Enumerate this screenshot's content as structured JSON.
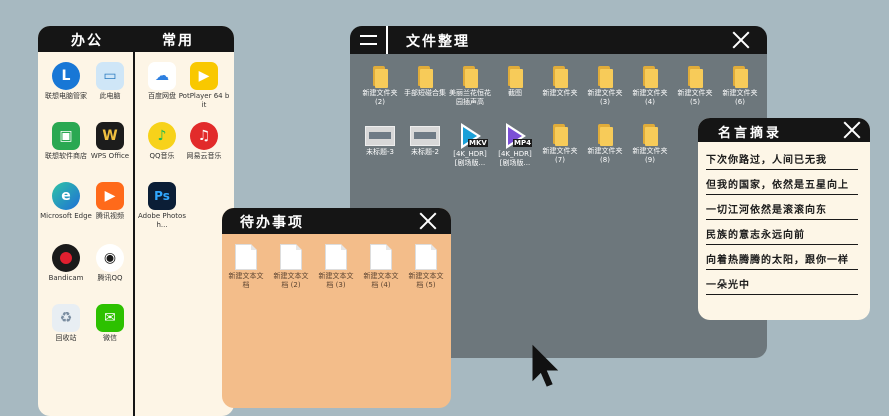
{
  "left_panel": {
    "col1_title": "办公",
    "col2_title": "常用",
    "col1_apps": [
      {
        "label": "联想电脑管家",
        "icon": "lenovo-icon"
      },
      {
        "label": "联想软件商店",
        "icon": "store-icon"
      },
      {
        "label": "Microsoft Edge",
        "icon": "edge-icon"
      },
      {
        "label": "Bandicam",
        "icon": "bandicam-icon"
      },
      {
        "label": "回收站",
        "icon": "recycle-bin-icon"
      }
    ],
    "col2_apps": [
      {
        "label": "此电脑",
        "icon": "computer-icon"
      },
      {
        "label": "WPS Office",
        "icon": "wps-icon"
      },
      {
        "label": "腾讯视频",
        "icon": "video-icon"
      },
      {
        "label": "腾讯QQ",
        "icon": "qq-icon"
      },
      {
        "label": "微信",
        "icon": "wechat-icon"
      }
    ],
    "col3_apps": [
      {
        "label": "百度网盘",
        "icon": "baidu-netdisk-icon"
      },
      {
        "label": "PotPlayer 64 bit",
        "icon": "potplayer-icon"
      },
      {
        "label": "QQ音乐",
        "icon": "qqmusic-icon"
      },
      {
        "label": "网易云音乐",
        "icon": "netease-music-icon"
      },
      {
        "label": "Adobe Photosh...",
        "icon": "photoshop-icon"
      }
    ]
  },
  "files_window": {
    "title": "文件整理",
    "row1": [
      {
        "label": "新建文件夹 (2)",
        "type": "folder"
      },
      {
        "label": "手部短碰合集",
        "type": "folder"
      },
      {
        "label": "美丽兰花恒花园插声高",
        "type": "folder"
      },
      {
        "label": "截图",
        "type": "folder"
      },
      {
        "label": "新建文件夹",
        "type": "folder"
      },
      {
        "label": "新建文件夹 (3)",
        "type": "folder"
      },
      {
        "label": "新建文件夹 (4)",
        "type": "folder"
      },
      {
        "label": "新建文件夹 (5)",
        "type": "folder"
      },
      {
        "label": "新建文件夹 (6)",
        "type": "folder"
      }
    ],
    "row2": [
      {
        "label": "未标题-3",
        "type": "image"
      },
      {
        "label": "未标题-2",
        "type": "image"
      },
      {
        "label": "[4K_HDR] [剧场版...",
        "type": "video",
        "tag": "MKV",
        "color": "#1aa0d8"
      },
      {
        "label": "[4K_HDR] [剧场版...",
        "type": "video",
        "tag": "MP4",
        "color": "#7b4fd6"
      },
      {
        "label": "新建文件夹 (7)",
        "type": "folder"
      },
      {
        "label": "新建文件夹 (8)",
        "type": "folder"
      },
      {
        "label": "新建文件夹 (9)",
        "type": "folder"
      }
    ]
  },
  "todo_window": {
    "title": "待办事项",
    "files": [
      {
        "label": "新建文本文档"
      },
      {
        "label": "新建文本文档 (2)"
      },
      {
        "label": "新建文本文档 (3)"
      },
      {
        "label": "新建文本文档 (4)"
      },
      {
        "label": "新建文本文档 (5)"
      }
    ]
  },
  "quote_window": {
    "title": "名言摘录",
    "lines": [
      "下次你路过，人间已无我",
      "但我的国家，依然是五星向上",
      "一切江河依然是滚滚向东",
      "民族的意志永远向前",
      "向着热腾腾的太阳，跟你一样",
      "一朵光中"
    ]
  },
  "colors": {
    "background": "#a7b9c1",
    "files_bg": "#6d777c",
    "todo_bg": "#f3bd8a",
    "panel_bg": "#fdf5e6",
    "titlebar": "#151515"
  }
}
